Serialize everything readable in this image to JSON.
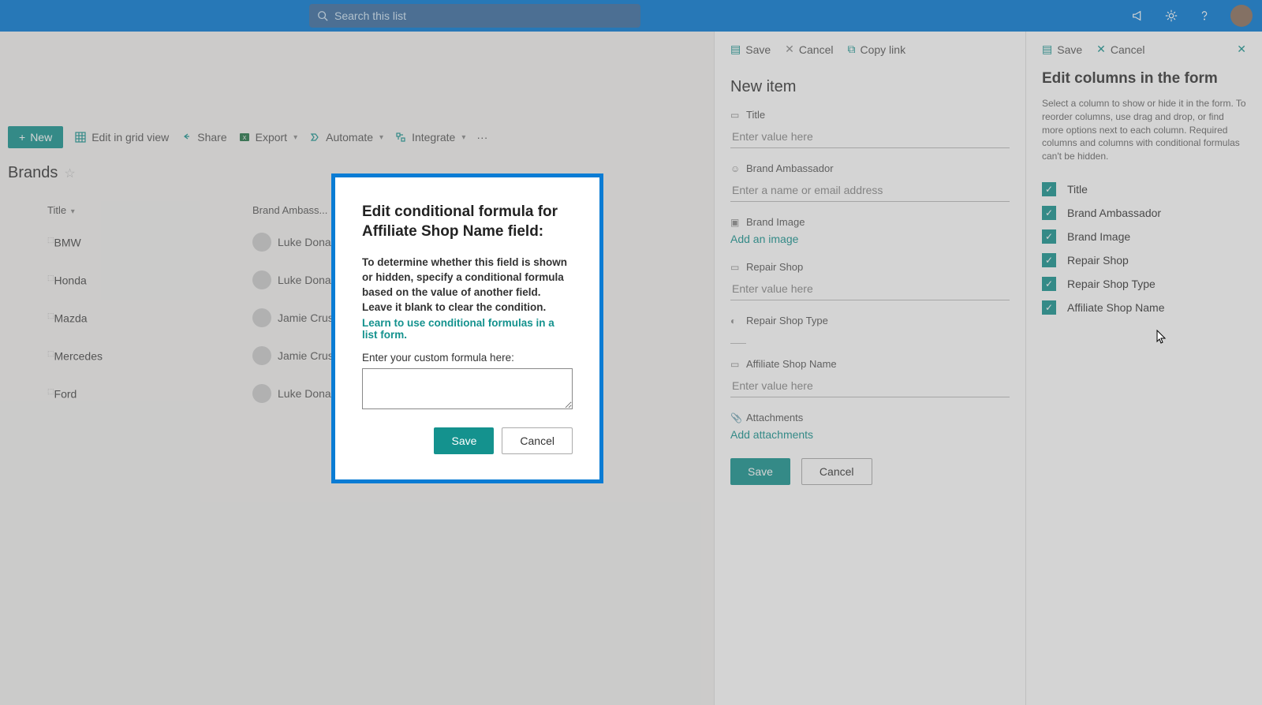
{
  "search": {
    "placeholder": "Search this list"
  },
  "toolbar": {
    "new_label": "New",
    "edit_grid": "Edit in grid view",
    "share": "Share",
    "export": "Export",
    "automate": "Automate",
    "integrate": "Integrate"
  },
  "list": {
    "name": "Brands",
    "col_title": "Title",
    "col_ambassador": "Brand Ambass...",
    "rows": [
      {
        "title": "BMW",
        "ambassador": "Luke Donald"
      },
      {
        "title": "Honda",
        "ambassador": "Luke Donald"
      },
      {
        "title": "Mazda",
        "ambassador": "Jamie Crust"
      },
      {
        "title": "Mercedes",
        "ambassador": "Jamie Crust"
      },
      {
        "title": "Ford",
        "ambassador": "Luke Donald"
      }
    ]
  },
  "panel": {
    "save": "Save",
    "cancel": "Cancel",
    "copy_link": "Copy link",
    "heading": "New item",
    "fields": {
      "title": {
        "label": "Title",
        "placeholder": "Enter value here"
      },
      "ambassador": {
        "label": "Brand Ambassador",
        "placeholder": "Enter a name or email address"
      },
      "image": {
        "label": "Brand Image",
        "link": "Add an image"
      },
      "repair_shop": {
        "label": "Repair Shop",
        "placeholder": "Enter value here"
      },
      "repair_shop_type": {
        "label": "Repair Shop Type"
      },
      "affiliate": {
        "label": "Affiliate Shop Name",
        "placeholder": "Enter value here"
      },
      "attachments": {
        "label": "Attachments",
        "link": "Add attachments"
      }
    },
    "btn_save": "Save",
    "btn_cancel": "Cancel"
  },
  "rpanel": {
    "save": "Save",
    "cancel": "Cancel",
    "heading": "Edit columns in the form",
    "desc": "Select a column to show or hide it in the form. To reorder columns, use drag and drop, or find more options next to each column. Required columns and columns with conditional formulas can't be hidden.",
    "items": [
      "Title",
      "Brand Ambassador",
      "Brand Image",
      "Repair Shop",
      "Repair Shop Type",
      "Affiliate Shop Name"
    ]
  },
  "modal": {
    "heading": "Edit conditional formula for Affiliate Shop Name field:",
    "desc": "To determine whether this field is shown or hidden, specify a conditional formula based on the value of another field. Leave it blank to clear the condition.",
    "link": "Learn to use conditional formulas in a list form.",
    "label": "Enter your custom formula here:",
    "save": "Save",
    "cancel": "Cancel"
  }
}
